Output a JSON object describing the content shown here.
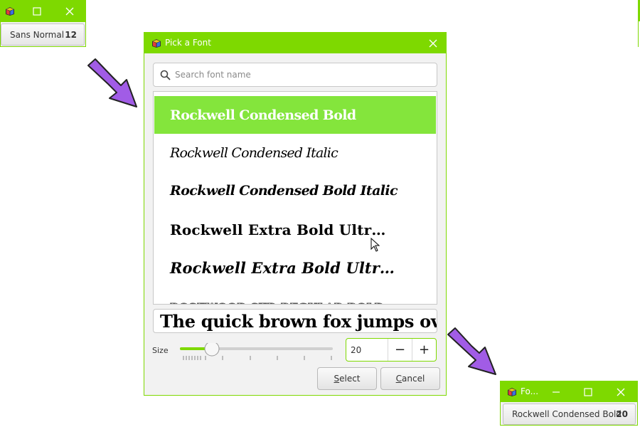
{
  "top_window": {
    "font_button": {
      "name": "Sans Normal",
      "size": "12"
    }
  },
  "dialog": {
    "title": "Pick a Font",
    "search": {
      "placeholder": "Search font name",
      "value": ""
    },
    "fonts": [
      {
        "label": "Rockwell Condensed Bold",
        "selected": true
      },
      {
        "label": "Rockwell Condensed Italic",
        "selected": false
      },
      {
        "label": "Rockwell Condensed Bold Italic",
        "selected": false
      },
      {
        "label": "Rockwell Extra Bold Ultr…",
        "selected": false
      },
      {
        "label": "Rockwell Extra Bold Ultr…",
        "selected": false
      },
      {
        "label": "ROSEWOOD STD REGULAR BOLD",
        "selected": false
      }
    ],
    "preview_text": "The quick brown fox jumps over th",
    "size": {
      "label": "Size",
      "value": "20",
      "slider_fraction": 0.21,
      "decrement_label": "−",
      "increment_label": "+"
    },
    "select_button": {
      "underlined": "S",
      "rest": "elect"
    },
    "cancel_button": {
      "underlined": "C",
      "rest": "ancel"
    }
  },
  "bottom_window": {
    "title": "Fo...",
    "font_button": {
      "name": "Rockwell Condensed Bold",
      "size": "20"
    }
  },
  "colors": {
    "title_bar": "#7ed900",
    "selected_row": "#84e53c",
    "arrow_fill": "#a15ce6",
    "arrow_outline": "#222222"
  },
  "icons": {
    "app": "app-cube-icon",
    "minimize": "minimize-icon",
    "maximize": "maximize-icon",
    "close": "close-icon",
    "search": "search-icon",
    "cursor": "mouse-pointer-icon",
    "arrow": "curved-arrow-icon"
  }
}
